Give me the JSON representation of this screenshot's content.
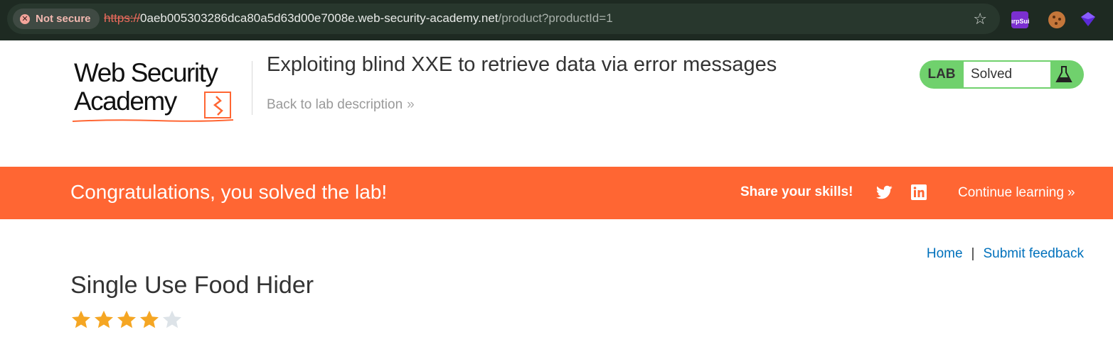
{
  "browser": {
    "security_label": "Not secure",
    "url_scheme": "https://",
    "url_host": "0aeb005303286dca80a5d63d00e7008e.web-security-academy.net",
    "url_path": "/product?productId=1",
    "extension_burp_label": "ırpSui"
  },
  "header": {
    "logo_line1": "Web Security",
    "logo_line2": "Academy",
    "lab_title": "Exploiting blind XXE to retrieve data via error messages",
    "back_link": "Back to lab description",
    "lab_badge_label": "LAB",
    "lab_status": "Solved"
  },
  "banner": {
    "message": "Congratulations, you solved the lab!",
    "share_label": "Share your skills!",
    "continue_label": "Continue learning"
  },
  "nav": {
    "home": "Home",
    "separator": "|",
    "feedback": "Submit feedback"
  },
  "product": {
    "name": "Single Use Food Hider",
    "rating": 4,
    "rating_max": 5
  },
  "colors": {
    "accent": "#ff6633",
    "lab_solved": "#70d16d",
    "link": "#0071bc",
    "star_filled": "#f5a623",
    "star_empty": "#dde3e8"
  },
  "icons": [
    "not-secure-icon",
    "bookmark-star-icon",
    "burp-extension-icon",
    "cookie-extension-icon",
    "gem-extension-icon",
    "flask-icon",
    "twitter-icon",
    "linkedin-icon",
    "chevron-right-icon",
    "rating-star-icon"
  ]
}
